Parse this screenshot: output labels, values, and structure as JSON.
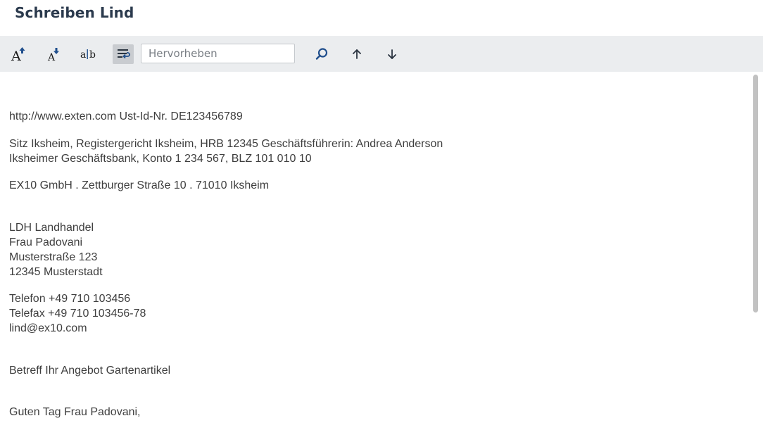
{
  "window": {
    "title": "Schreiben Lind"
  },
  "toolbar": {
    "buttons": [
      {
        "name": "increase-font-size-button",
        "icon": "font-size-increase-icon"
      },
      {
        "name": "decrease-font-size-button",
        "icon": "font-size-decrease-icon"
      },
      {
        "name": "text-compare-button",
        "icon": "text-separator-icon"
      },
      {
        "name": "word-wrap-button",
        "icon": "word-wrap-icon",
        "active": true
      }
    ],
    "search": {
      "placeholder": "Hervorheben",
      "value": ""
    },
    "search_icon": "magnifier-icon",
    "prev_icon": "arrow-up-icon",
    "next_icon": "arrow-down-icon"
  },
  "document": {
    "company_web": "http://www.exten.com Ust-Id-Nr. DE123456789",
    "company_registry_1": "Sitz Iksheim, Registergericht Iksheim, HRB 12345 Geschäftsführerin: Andrea Anderson",
    "company_registry_2": "Iksheimer Geschäftsbank, Konto 1 234 567, BLZ 101 010 10",
    "sender_line": "EX10 GmbH . Zettburger Straße 10 . 71010 Iksheim",
    "recipient": {
      "company": "LDH Landhandel",
      "name": "Frau Padovani",
      "street": "Musterstraße 123",
      "city": "12345 Musterstadt"
    },
    "contact": {
      "phone": "Telefon +49 710 103456",
      "fax": "Telefax +49 710 103456-78",
      "email": "lind@ex10.com"
    },
    "subject": "Betreff Ihr Angebot Gartenartikel",
    "greeting": "Guten Tag Frau Padovani,"
  },
  "colors": {
    "title": "#2b3a4d",
    "toolbar_bg": "#ebedef",
    "icon_blue": "#1f4e8c",
    "text": "#3e3e3e"
  }
}
